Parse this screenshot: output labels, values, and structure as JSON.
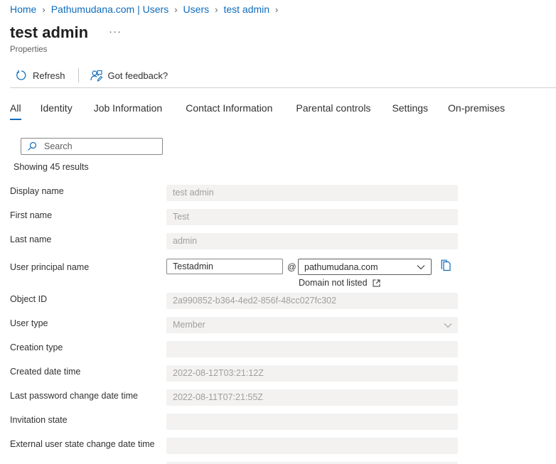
{
  "breadcrumb": [
    "Home",
    "Pathumudana.com | Users",
    "Users",
    "test admin"
  ],
  "header": {
    "title": "test admin",
    "more_label": "···",
    "subtitle": "Properties"
  },
  "toolbar": {
    "refresh_label": "Refresh",
    "feedback_label": "Got feedback?"
  },
  "tabs": [
    "All",
    "Identity",
    "Job Information",
    "Contact Information",
    "Parental controls",
    "Settings",
    "On-premises"
  ],
  "active_tab": "All",
  "search": {
    "placeholder": "Search",
    "value": ""
  },
  "results_text": "Showing 45 results",
  "properties": {
    "display_name": {
      "label": "Display name",
      "value": "test admin"
    },
    "first_name": {
      "label": "First name",
      "value": "Test"
    },
    "last_name": {
      "label": "Last name",
      "value": "admin"
    },
    "upn": {
      "label": "User principal name",
      "value": "Testadmin",
      "at": "@",
      "domain": "pathumudana.com",
      "domain_note": "Domain not listed"
    },
    "object_id": {
      "label": "Object ID",
      "value": "2a990852-b364-4ed2-856f-48cc027fc302"
    },
    "user_type": {
      "label": "User type",
      "value": "Member"
    },
    "creation_type": {
      "label": "Creation type",
      "value": ""
    },
    "created_date_time": {
      "label": "Created date time",
      "value": "2022-08-12T03:21:12Z"
    },
    "last_password_change": {
      "label": "Last password change date time",
      "value": "2022-08-11T07:21:55Z"
    },
    "invitation_state": {
      "label": "Invitation state",
      "value": ""
    },
    "external_user_state_change": {
      "label": "External user state change date time",
      "value": ""
    }
  },
  "colors": {
    "accent": "#0f6cbd",
    "readonly_bg": "#f3f2f1",
    "readonly_text": "#a19f9d",
    "text": "#323130"
  }
}
